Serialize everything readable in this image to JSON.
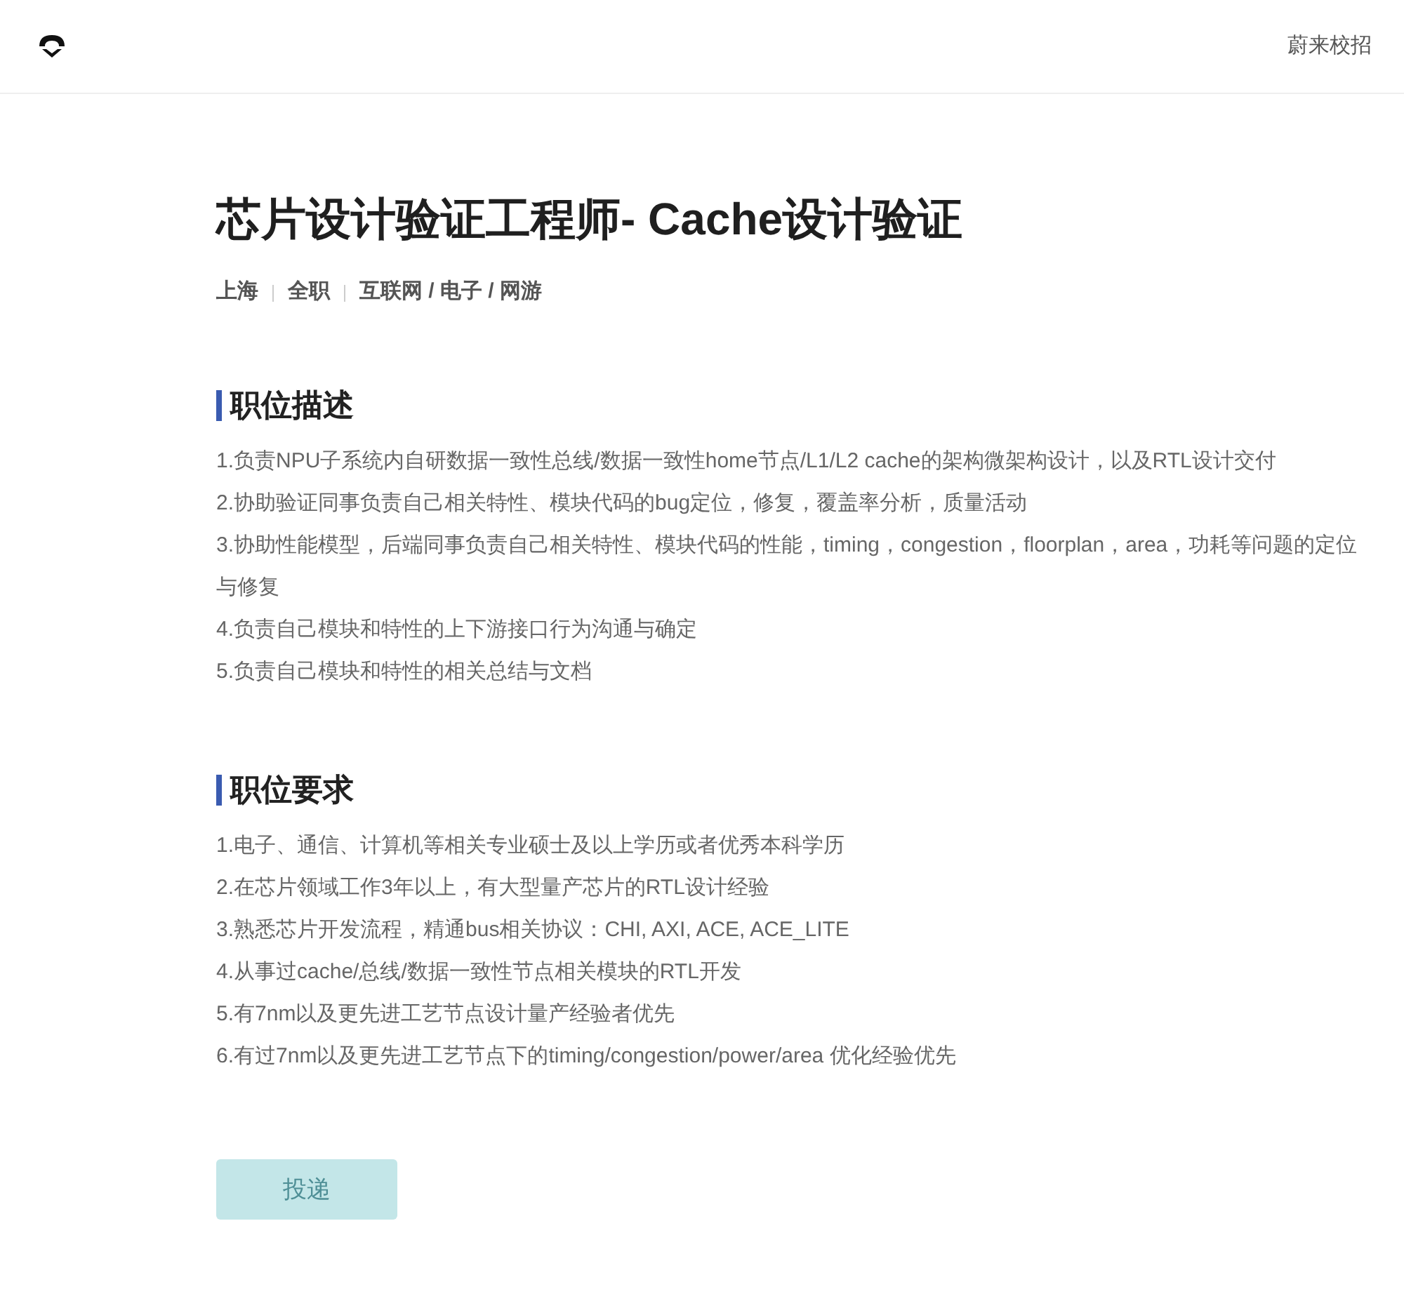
{
  "header": {
    "brand_link": "蔚来校招"
  },
  "job": {
    "title": "芯片设计验证工程师- Cache设计验证",
    "tags": [
      "上海",
      "全职",
      "互联网 / 电子 / 网游"
    ]
  },
  "sections": [
    {
      "heading": "职位描述",
      "items": [
        "1.负责NPU子系统内自研数据一致性总线/数据一致性home节点/L1/L2 cache的架构微架构设计，以及RTL设计交付",
        "2.协助验证同事负责自己相关特性、模块代码的bug定位，修复，覆盖率分析，质量活动",
        "3.协助性能模型，后端同事负责自己相关特性、模块代码的性能，timing，congestion，floorplan，area，功耗等问题的定位与修复",
        "4.负责自己模块和特性的上下游接口行为沟通与确定",
        "5.负责自己模块和特性的相关总结与文档"
      ]
    },
    {
      "heading": "职位要求",
      "items": [
        "1.电子、通信、计算机等相关专业硕士及以上学历或者优秀本科学历",
        "2.在芯片领域工作3年以上，有大型量产芯片的RTL设计经验",
        "3.熟悉芯片开发流程，精通bus相关协议：CHI, AXI, ACE, ACE_LITE",
        "4.从事过cache/总线/数据一致性节点相关模块的RTL开发",
        "5.有7nm以及更先进工艺节点设计量产经验者优先",
        "6.有过7nm以及更先进工艺节点下的timing/congestion/power/area 优化经验优先"
      ]
    }
  ],
  "apply_button": {
    "label": "投递",
    "disabled": true
  }
}
